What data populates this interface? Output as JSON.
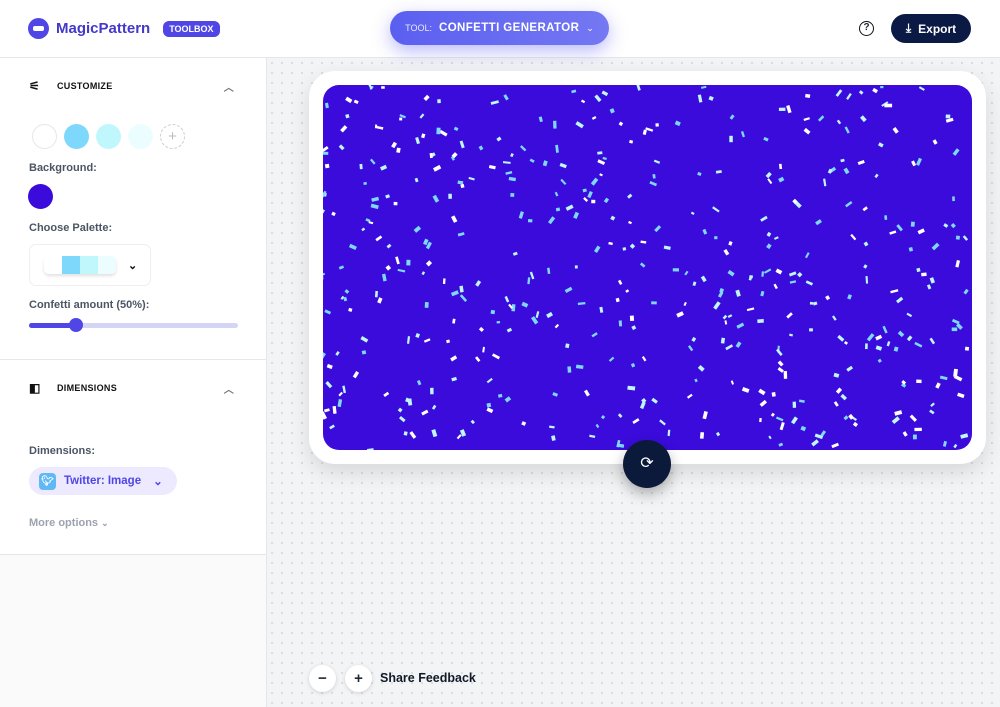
{
  "header": {
    "brand": "MagicPattern",
    "badge": "TOOLBOX",
    "tool_prefix": "TOOL:",
    "tool_name": "CONFETTI GENERATOR",
    "help": "?",
    "export_label": "Export"
  },
  "customize": {
    "title": "CUSTOMIZE",
    "confetti_colors": [
      "#ffffff",
      "#7dd8fb",
      "#c0f7fc",
      "#ecfdff"
    ],
    "background_label": "Background:",
    "background_color": "#3a0bdb",
    "palette_label": "Choose Palette:",
    "amount_label": "Confetti amount (50%):",
    "amount_percent": 50
  },
  "dimensions": {
    "title": "DIMENSIONS",
    "label": "Dimensions:",
    "value": "Twitter: Image",
    "more_options": "More options"
  },
  "canvas": {
    "share_feedback": "Share Feedback",
    "zoom_out": "−",
    "zoom_in": "+"
  },
  "colors": {
    "accent": "#4f46e5",
    "dark": "#0b1a45"
  }
}
